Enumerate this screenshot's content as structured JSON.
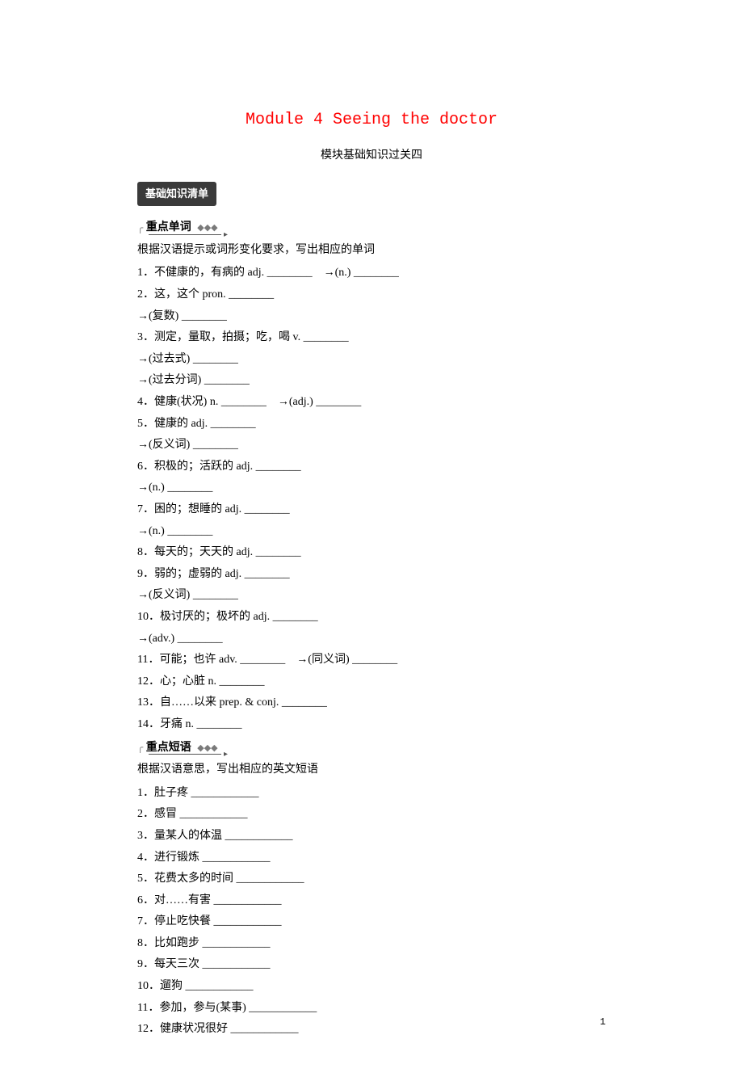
{
  "title": "Module 4 Seeing the doctor",
  "subtitle": "模块基础知识过关四",
  "sectionTag": "基础知识清单",
  "wordsHeader": "重点单词",
  "phrasesHeader": "重点短语",
  "diamonds": "◆◆◆",
  "wordsInstruction": "根据汉语提示或词形变化要求，写出相应的单词",
  "phrasesInstruction": "根据汉语意思，写出相应的英文短语",
  "words": {
    "w1": "1．不健康的，有病的 adj. ________　→(n.) ________",
    "w2a": "2．这，这个 pron. ________",
    "w2b": "→(复数) ________",
    "w3a": "3．测定，量取，拍摄；吃，喝 v. ________",
    "w3b": "→(过去式) ________",
    "w3c": "→(过去分词) ________",
    "w4": "4．健康(状况) n. ________　→(adj.) ________",
    "w5a": "5．健康的 adj. ________",
    "w5b": "→(反义词) ________",
    "w6a": "6．积极的；活跃的 adj. ________",
    "w6b": "→(n.) ________",
    "w7a": "7．困的；想睡的 adj. ________",
    "w7b": "→(n.) ________",
    "w8": "8．每天的；天天的 adj. ________",
    "w9a": "9．弱的；虚弱的 adj. ________",
    "w9b": "→(反义词) ________",
    "w10a": "10．极讨厌的；极坏的 adj. ________",
    "w10b": "→(adv.) ________",
    "w11": "11．可能；也许 adv. ________　→(同义词) ________",
    "w12": "12．心；心脏 n. ________",
    "w13": "13．自……以来 prep. & conj. ________",
    "w14": "14．牙痛 n. ________"
  },
  "phrases": {
    "p1": "1．肚子疼 ____________",
    "p2": "2．感冒 ____________",
    "p3": "3．量某人的体温 ____________",
    "p4": "4．进行锻炼 ____________",
    "p5": "5．花费太多的时间 ____________",
    "p6": "6．对……有害 ____________",
    "p7": "7．停止吃快餐 ____________",
    "p8": "8．比如跑步 ____________",
    "p9": "9．每天三次 ____________",
    "p10": "10．遛狗 ____________",
    "p11": "11．参加，参与(某事) ____________",
    "p12": "12．健康状况很好 ____________"
  },
  "pageNumber": "1"
}
